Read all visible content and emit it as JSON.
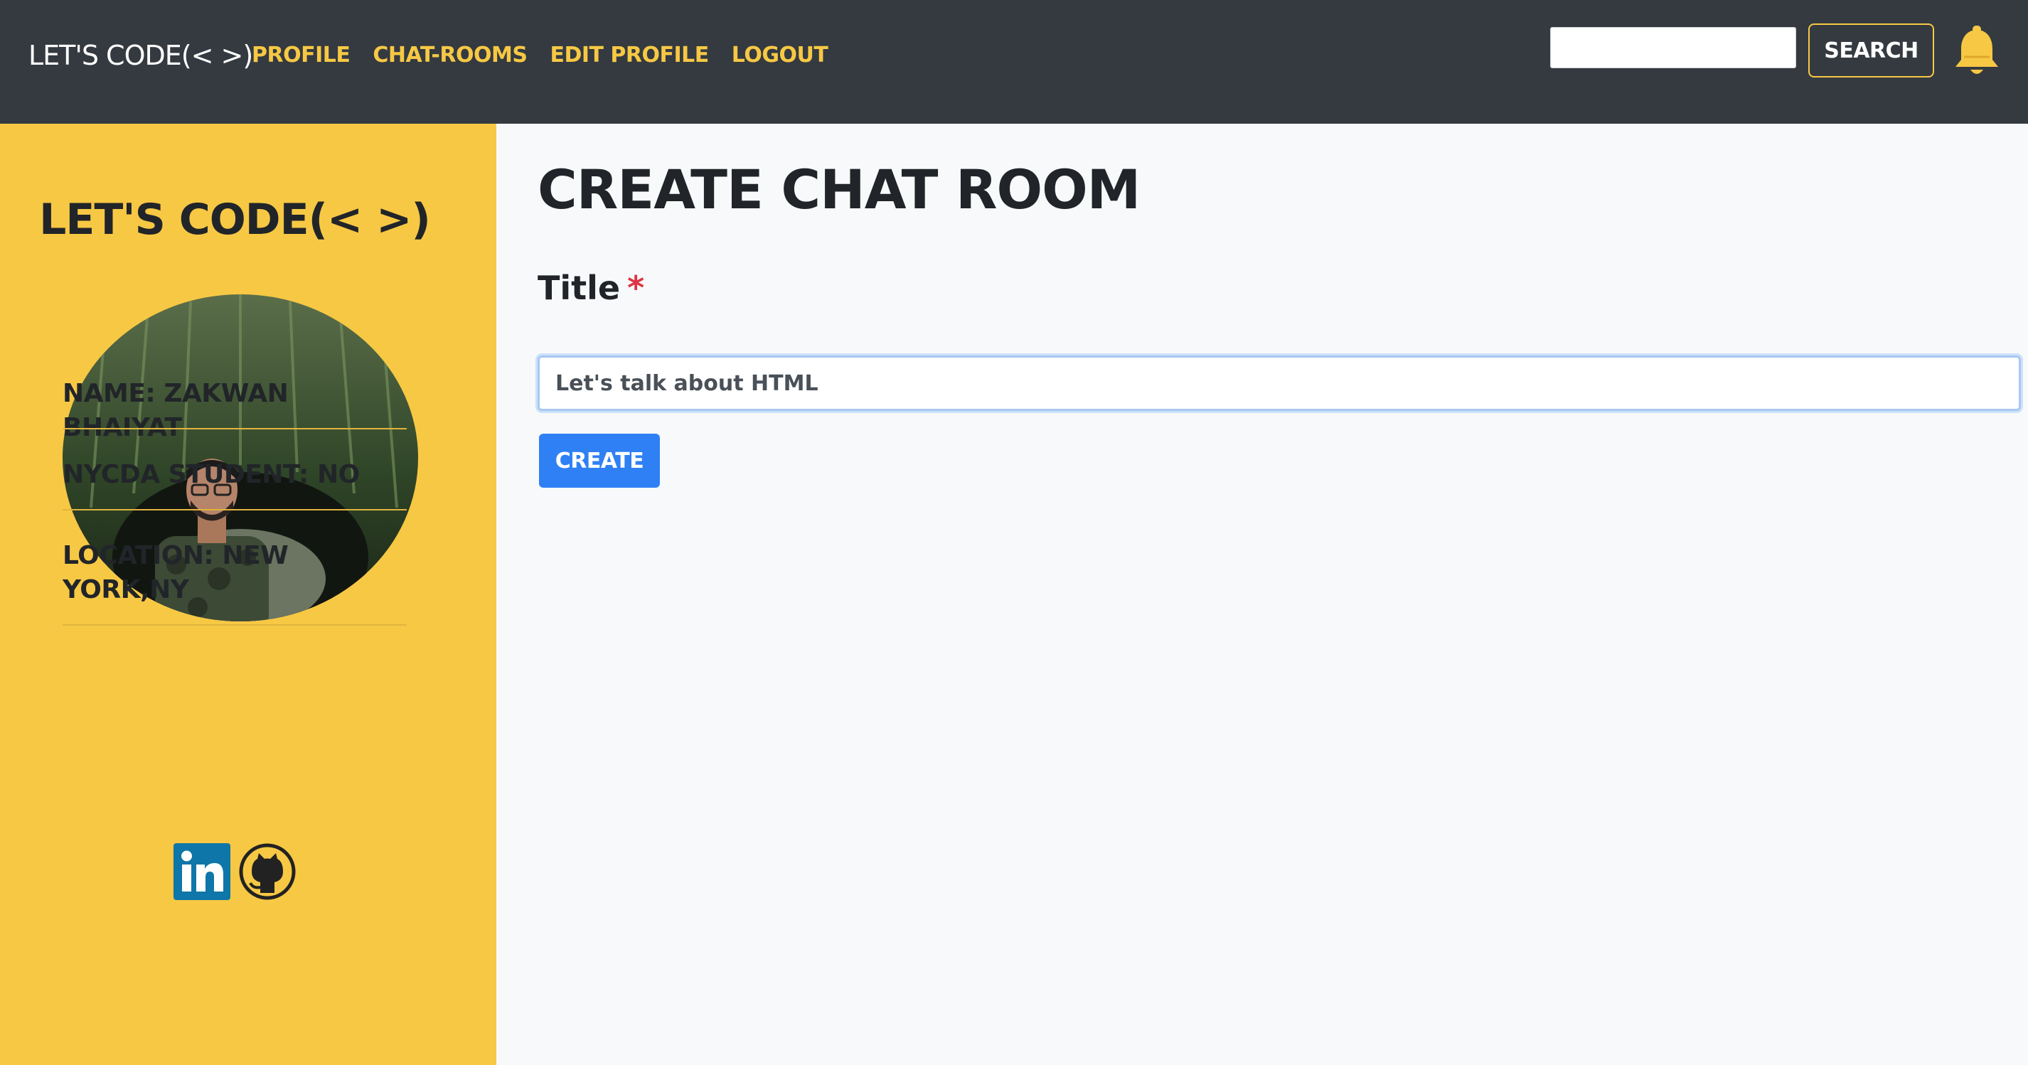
{
  "navbar": {
    "brand": "LET'S CODE(< >)",
    "links": [
      {
        "label": "PROFILE"
      },
      {
        "label": "CHAT-ROOMS"
      },
      {
        "label": "EDIT PROFILE"
      },
      {
        "label": "LOGOUT"
      }
    ],
    "search_value": "",
    "search_button": "SEARCH",
    "notification_icon": "bell-icon"
  },
  "sidebar": {
    "title": "LET'S CODE(< >)",
    "avatar_alt": "profile-photo",
    "name": "NAME: ZAKWAN BHAIYAT",
    "student": "NYCDA STUDENT: NO",
    "location": "LOCATION: NEW YORK,NY",
    "social_icons": [
      "linkedin-icon",
      "github-icon"
    ]
  },
  "main": {
    "title": "CREATE CHAT ROOM",
    "field_label": "Title",
    "required_mark": "*",
    "title_value": "Let's talk about HTML",
    "create_button": "CREATE"
  },
  "colors": {
    "navbar_bg": "#343a40",
    "accent_yellow": "#f7c844",
    "primary_blue": "#2f80f4",
    "required_red": "#dc3545",
    "page_bg": "#f8f9fa"
  }
}
